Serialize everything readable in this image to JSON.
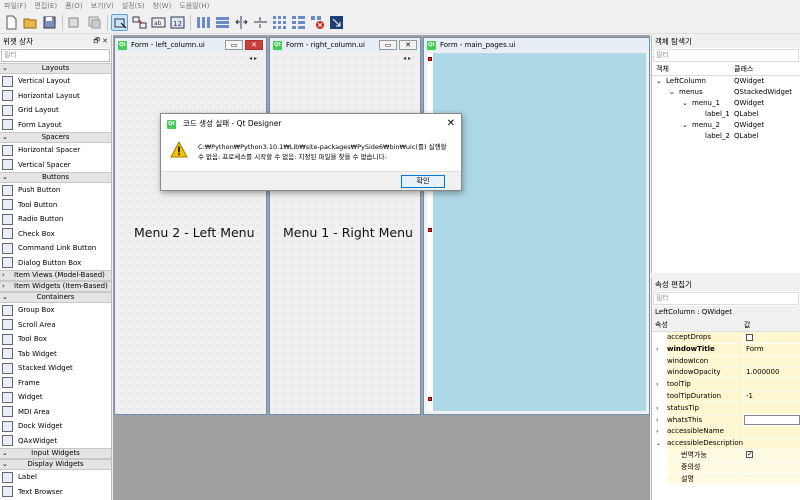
{
  "menubar": [
    "파일(F)",
    "편집(E)",
    "폼(O)",
    "보기(V)",
    "설정(S)",
    "창(W)",
    "도움말(H)"
  ],
  "widget_box": {
    "title": "위젯 상자",
    "filter_placeholder": "필터",
    "categories": [
      {
        "name": "Layouts",
        "open": true,
        "items": [
          "Vertical Layout",
          "Horizontal Layout",
          "Grid Layout",
          "Form Layout"
        ]
      },
      {
        "name": "Spacers",
        "open": true,
        "items": [
          "Horizontal Spacer",
          "Vertical Spacer"
        ]
      },
      {
        "name": "Buttons",
        "open": true,
        "items": [
          "Push Button",
          "Tool Button",
          "Radio Button",
          "Check Box",
          "Command Link Button",
          "Dialog Button Box"
        ]
      },
      {
        "name": "Item Views (Model-Based)",
        "open": false,
        "items": []
      },
      {
        "name": "Item Widgets (Item-Based)",
        "open": false,
        "items": []
      },
      {
        "name": "Containers",
        "open": true,
        "items": [
          "Group Box",
          "Scroll Area",
          "Tool Box",
          "Tab Widget",
          "Stacked Widget",
          "Frame",
          "Widget",
          "MDI Area",
          "Dock Widget",
          "QAxWidget"
        ]
      },
      {
        "name": "Input Widgets",
        "open": true,
        "items": []
      },
      {
        "name": "Display Widgets",
        "open": true,
        "items": [
          "Label",
          "Text Browser"
        ]
      }
    ]
  },
  "forms": {
    "left": {
      "title": "Form - left_column.ui",
      "text": "Menu 2 - Left Menu"
    },
    "right": {
      "title": "Form - right_column.ui",
      "text": "Menu 1 - Right Menu"
    },
    "main": {
      "title": "Form - main_pages.ui"
    }
  },
  "dialog": {
    "title": "코드 생성 실패 - Qt Designer",
    "message_line1": "C:₩Python₩Python3.10.1₩Lib₩site-packages₩PySide6₩bin₩uic(를) 실행할",
    "message_line2": "수 없음: 프로세스를 시작할 수 없음: 지정된 파일을 찾을 수 없습니다.",
    "ok_label": "확인"
  },
  "object_inspector": {
    "title": "객체 탐색기",
    "filter_placeholder": "필터",
    "col_object": "객체",
    "col_class": "클래스",
    "rows": [
      {
        "name": "LeftColumn",
        "cls": "QWidget",
        "depth": 0,
        "expanded": true
      },
      {
        "name": "menus",
        "cls": "QStackedWidget",
        "depth": 1,
        "expanded": true
      },
      {
        "name": "menu_1",
        "cls": "QWidget",
        "depth": 2,
        "expanded": true
      },
      {
        "name": "label_1",
        "cls": "QLabel",
        "depth": 3,
        "expanded": null
      },
      {
        "name": "menu_2",
        "cls": "QWidget",
        "depth": 2,
        "expanded": true
      },
      {
        "name": "label_2",
        "cls": "QLabel",
        "depth": 3,
        "expanded": null
      }
    ]
  },
  "property_editor": {
    "title": "속성 편집기",
    "filter_placeholder": "필터",
    "context": "LeftColumn : QWidget",
    "col_property": "속성",
    "col_value": "값",
    "rows": [
      {
        "name": "acceptDrops",
        "value": "",
        "check": false,
        "bold": false,
        "expander": ""
      },
      {
        "name": "windowTitle",
        "value": "Form",
        "check": null,
        "bold": true,
        "expander": ">"
      },
      {
        "name": "windowIcon",
        "value": "",
        "check": null,
        "bold": false,
        "expander": ""
      },
      {
        "name": "windowOpacity",
        "value": "1.000000",
        "check": null,
        "bold": false,
        "expander": ""
      },
      {
        "name": "toolTip",
        "value": "",
        "check": null,
        "bold": false,
        "expander": ">"
      },
      {
        "name": "toolTipDuration",
        "value": "-1",
        "check": null,
        "bold": false,
        "expander": ""
      },
      {
        "name": "statusTip",
        "value": "",
        "check": null,
        "bold": false,
        "expander": ">"
      },
      {
        "name": "whatsThis",
        "value": "",
        "check": null,
        "bold": false,
        "expander": ">",
        "editing": true
      },
      {
        "name": "accessibleName",
        "value": "",
        "check": null,
        "bold": false,
        "expander": ">"
      },
      {
        "name": "accessibleDescription",
        "value": "",
        "check": null,
        "bold": false,
        "expander": "v"
      },
      {
        "name": "번역가능",
        "value": "",
        "check": true,
        "bold": false,
        "expander": "",
        "sub": true
      },
      {
        "name": "중의성",
        "value": "",
        "check": null,
        "bold": false,
        "expander": "",
        "sub": true
      },
      {
        "name": "설명",
        "value": "",
        "check": null,
        "bold": false,
        "expander": "",
        "sub": true
      }
    ]
  },
  "colors": {
    "main_page_bg": "#add8e6",
    "accent": "#0078d7",
    "qt_green": "#41cd52"
  }
}
